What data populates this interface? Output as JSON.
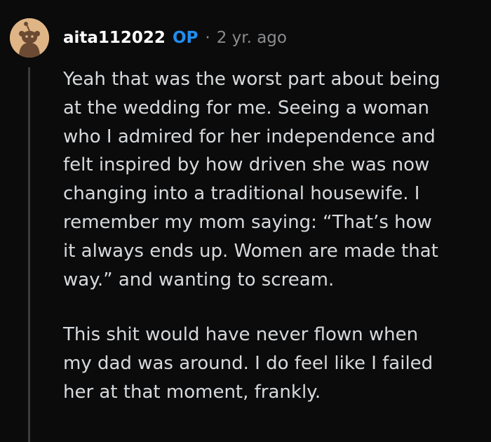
{
  "comment": {
    "author": "aita112022",
    "badge": "OP",
    "separator": "·",
    "timestamp": "2 yr. ago",
    "avatar_icon": "snoo-avatar-icon",
    "avatar_bg": "#e0b585",
    "paragraphs": [
      {
        "lines": [
          "Yeah that was the worst part about being",
          "at the wedding for me. Seeing a woman",
          "who I admired for her independence and",
          "felt inspired by how driven she was now",
          "changing into a traditional housewife. I",
          "remember my mom saying: “That’s how",
          "it always ends up. Women are made that",
          "way.” and wanting to scream."
        ]
      },
      {
        "lines": [
          "This shit would have never flown when",
          "my dad was around. I do feel like I failed",
          "her at that moment, frankly."
        ]
      }
    ]
  },
  "colors": {
    "background": "#0b0b0c",
    "text": "#d7dadc",
    "username": "#ffffff",
    "op_badge": "#1f8ef1",
    "muted": "#8a8c8e",
    "thread_line": "#3a3c3e"
  }
}
